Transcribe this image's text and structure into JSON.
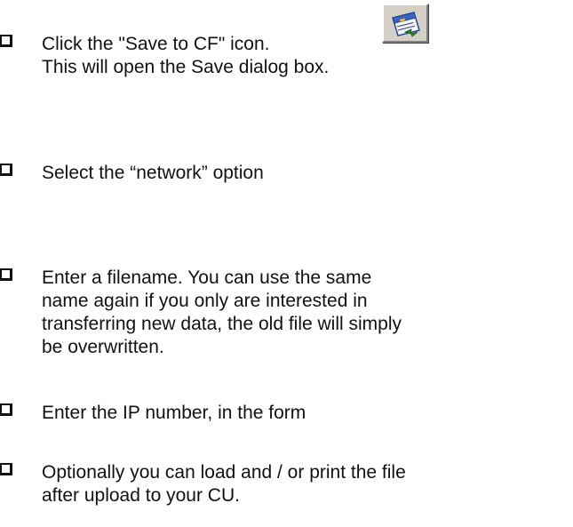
{
  "steps": [
    {
      "lines": [
        "Click the \"Save to CF\" icon.",
        "This will open the Save dialog box."
      ]
    },
    {
      "lines": [
        "Select the “network” option"
      ]
    },
    {
      "lines": [
        "Enter a filename. You can use the same",
        "name again if you only are interested in",
        "transferring new data, the old file will simply",
        "be overwritten."
      ]
    },
    {
      "lines": [
        "Enter the IP number, in the form"
      ]
    },
    {
      "lines": [
        "Optionally you can load and / or print the file",
        "after upload to your CU."
      ]
    }
  ],
  "icons": {
    "save_to_cf": "save-to-cf-icon"
  }
}
